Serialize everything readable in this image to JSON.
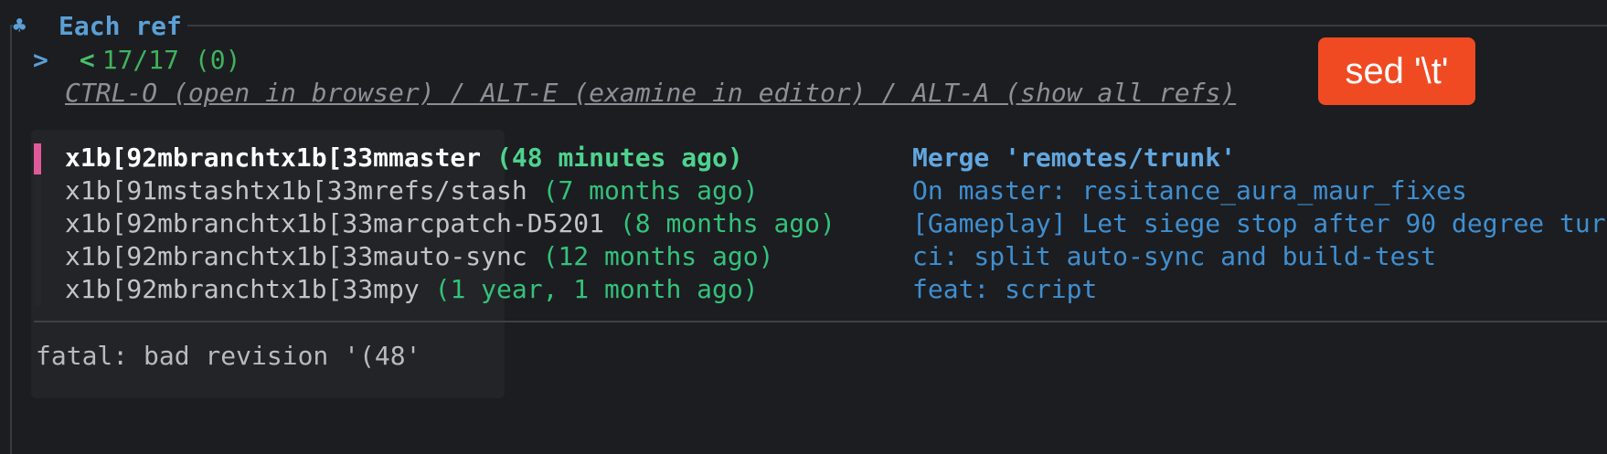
{
  "header": {
    "icon": "clover-icon",
    "title": "Each ref"
  },
  "prompt": {
    "symbol": ">",
    "count_prefix": "<",
    "count": "17/17 (0)"
  },
  "help_text": "CTRL-O (open in browser) / ALT-E (examine in editor) / ALT-A (show all refs)",
  "refs": [
    {
      "name": "x1b[92mbranchtx1b[33mmaster",
      "age": "(48 minutes ago)",
      "message": "Merge 'remotes/trunk'",
      "selected": true
    },
    {
      "name": "x1b[91mstashtx1b[33mrefs/stash",
      "age": "(7 months ago)",
      "message": "On master: resitance_aura_maur_fixes",
      "selected": false
    },
    {
      "name": "x1b[92mbranchtx1b[33marcpatch-D5201",
      "age": "(8 months ago)",
      "message": "[Gameplay] Let siege stop after 90 degree tur",
      "selected": false
    },
    {
      "name": "x1b[92mbranchtx1b[33mauto-sync",
      "age": "(12 months ago)",
      "message": "ci: split auto-sync and build-test",
      "selected": false
    },
    {
      "name": "x1b[92mbranchtx1b[33mpy",
      "age": "(1 year, 1 month ago)",
      "message": "feat: script",
      "selected": false
    }
  ],
  "preview": {
    "error": "fatal: bad revision '(48'"
  },
  "badge": {
    "label": "sed '\\t'",
    "color": "#f04a22"
  },
  "colors": {
    "accent": "#5aa0d6",
    "age": "#34c27a",
    "cursor": "#e05a9a",
    "message": "#3f8fd0"
  }
}
